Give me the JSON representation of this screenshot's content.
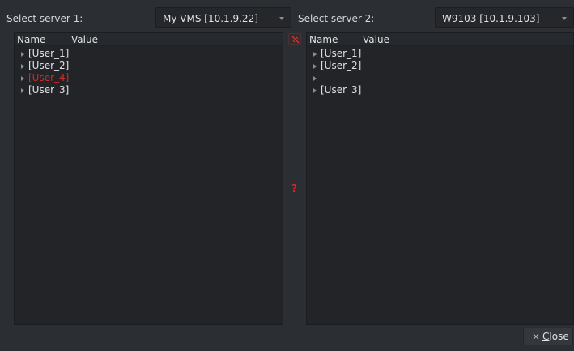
{
  "server1": {
    "label": "Select server 1:",
    "value": "My VMS  [10.1.9.22]"
  },
  "server2": {
    "label": "Select server 2:",
    "value": "W9103 [10.1.9.103]"
  },
  "columns": {
    "name": "Name",
    "value": "Value"
  },
  "left_rows": [
    {
      "text": "[User_1]",
      "highlight": false
    },
    {
      "text": "[User_2]",
      "highlight": false
    },
    {
      "text": "[User_4]",
      "highlight": true
    },
    {
      "text": "[User_3]",
      "highlight": false
    }
  ],
  "right_rows": [
    {
      "text": "[User_1]"
    },
    {
      "text": "[User_2]"
    },
    {
      "text": ""
    },
    {
      "text": "[User_3]"
    }
  ],
  "compare_marker": "?",
  "close_button": {
    "icon": "×",
    "mnemonic": "C",
    "label_rest": "lose"
  },
  "colors": {
    "diff_red": "#d02a2a",
    "background": "#2b2e33",
    "panel": "#222428"
  },
  "icons": {
    "compare_toggle": "link-icon",
    "expand": "triangle-right-icon",
    "close": "close-icon"
  }
}
